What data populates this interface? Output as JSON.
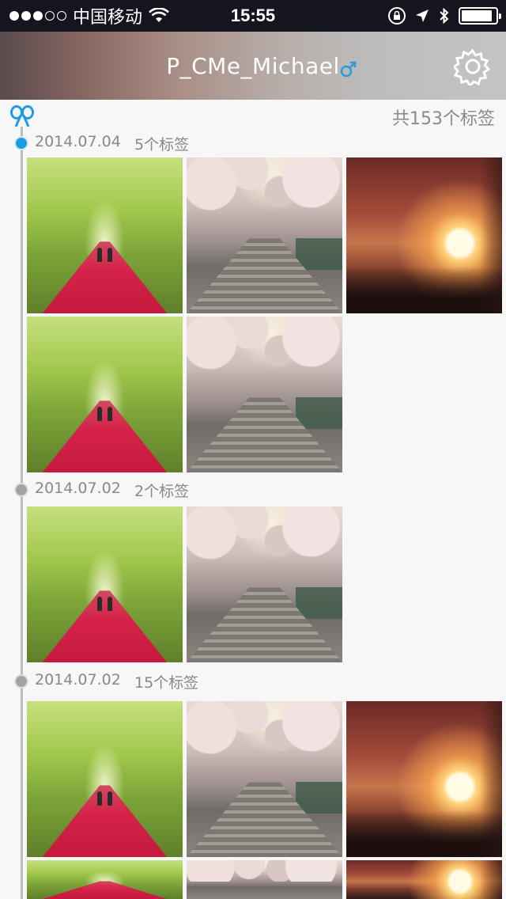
{
  "status_bar": {
    "carrier": "中国移动",
    "time": "15:55",
    "signal_bars_filled": 3,
    "signal_bars_total": 5,
    "battery_level": 0.9
  },
  "header": {
    "username": "P_CMe_Michael",
    "gender_icon": "male-symbol-icon",
    "gender_color": "#2a9be0",
    "settings_icon": "gear-icon"
  },
  "timeline": {
    "total_label": "共153个标签",
    "accent_color": "#1e9be5",
    "groups": [
      {
        "date": "2014.07.04",
        "tag_count": "5个标签",
        "active": true
      },
      {
        "date": "2014.07.02",
        "tag_count": "2个标签",
        "active": false
      },
      {
        "date": "2014.07.02",
        "tag_count": "15个标签",
        "active": false
      }
    ]
  }
}
